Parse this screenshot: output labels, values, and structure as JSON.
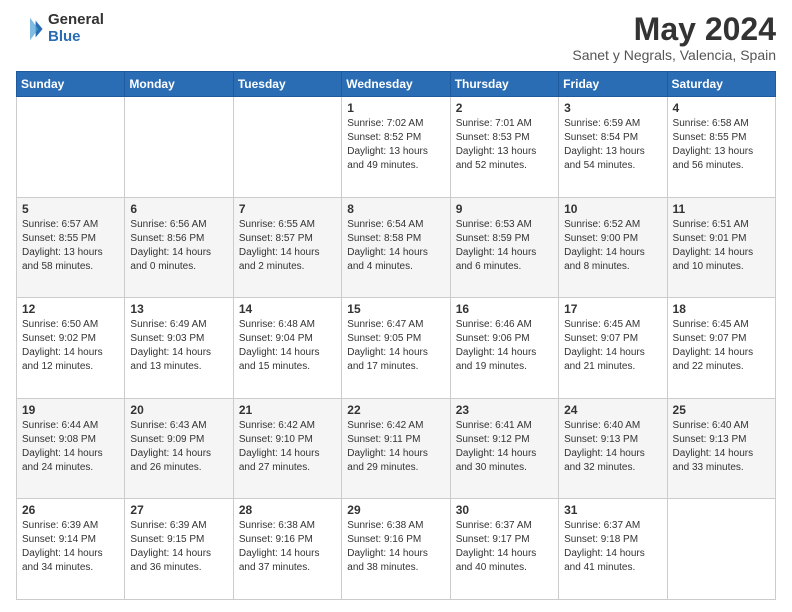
{
  "header": {
    "logo_general": "General",
    "logo_blue": "Blue",
    "title": "May 2024",
    "subtitle": "Sanet y Negrals, Valencia, Spain"
  },
  "days_of_week": [
    "Sunday",
    "Monday",
    "Tuesday",
    "Wednesday",
    "Thursday",
    "Friday",
    "Saturday"
  ],
  "weeks": [
    [
      {
        "day": "",
        "info": ""
      },
      {
        "day": "",
        "info": ""
      },
      {
        "day": "",
        "info": ""
      },
      {
        "day": "1",
        "info": "Sunrise: 7:02 AM\nSunset: 8:52 PM\nDaylight: 13 hours\nand 49 minutes."
      },
      {
        "day": "2",
        "info": "Sunrise: 7:01 AM\nSunset: 8:53 PM\nDaylight: 13 hours\nand 52 minutes."
      },
      {
        "day": "3",
        "info": "Sunrise: 6:59 AM\nSunset: 8:54 PM\nDaylight: 13 hours\nand 54 minutes."
      },
      {
        "day": "4",
        "info": "Sunrise: 6:58 AM\nSunset: 8:55 PM\nDaylight: 13 hours\nand 56 minutes."
      }
    ],
    [
      {
        "day": "5",
        "info": "Sunrise: 6:57 AM\nSunset: 8:55 PM\nDaylight: 13 hours\nand 58 minutes."
      },
      {
        "day": "6",
        "info": "Sunrise: 6:56 AM\nSunset: 8:56 PM\nDaylight: 14 hours\nand 0 minutes."
      },
      {
        "day": "7",
        "info": "Sunrise: 6:55 AM\nSunset: 8:57 PM\nDaylight: 14 hours\nand 2 minutes."
      },
      {
        "day": "8",
        "info": "Sunrise: 6:54 AM\nSunset: 8:58 PM\nDaylight: 14 hours\nand 4 minutes."
      },
      {
        "day": "9",
        "info": "Sunrise: 6:53 AM\nSunset: 8:59 PM\nDaylight: 14 hours\nand 6 minutes."
      },
      {
        "day": "10",
        "info": "Sunrise: 6:52 AM\nSunset: 9:00 PM\nDaylight: 14 hours\nand 8 minutes."
      },
      {
        "day": "11",
        "info": "Sunrise: 6:51 AM\nSunset: 9:01 PM\nDaylight: 14 hours\nand 10 minutes."
      }
    ],
    [
      {
        "day": "12",
        "info": "Sunrise: 6:50 AM\nSunset: 9:02 PM\nDaylight: 14 hours\nand 12 minutes."
      },
      {
        "day": "13",
        "info": "Sunrise: 6:49 AM\nSunset: 9:03 PM\nDaylight: 14 hours\nand 13 minutes."
      },
      {
        "day": "14",
        "info": "Sunrise: 6:48 AM\nSunset: 9:04 PM\nDaylight: 14 hours\nand 15 minutes."
      },
      {
        "day": "15",
        "info": "Sunrise: 6:47 AM\nSunset: 9:05 PM\nDaylight: 14 hours\nand 17 minutes."
      },
      {
        "day": "16",
        "info": "Sunrise: 6:46 AM\nSunset: 9:06 PM\nDaylight: 14 hours\nand 19 minutes."
      },
      {
        "day": "17",
        "info": "Sunrise: 6:45 AM\nSunset: 9:07 PM\nDaylight: 14 hours\nand 21 minutes."
      },
      {
        "day": "18",
        "info": "Sunrise: 6:45 AM\nSunset: 9:07 PM\nDaylight: 14 hours\nand 22 minutes."
      }
    ],
    [
      {
        "day": "19",
        "info": "Sunrise: 6:44 AM\nSunset: 9:08 PM\nDaylight: 14 hours\nand 24 minutes."
      },
      {
        "day": "20",
        "info": "Sunrise: 6:43 AM\nSunset: 9:09 PM\nDaylight: 14 hours\nand 26 minutes."
      },
      {
        "day": "21",
        "info": "Sunrise: 6:42 AM\nSunset: 9:10 PM\nDaylight: 14 hours\nand 27 minutes."
      },
      {
        "day": "22",
        "info": "Sunrise: 6:42 AM\nSunset: 9:11 PM\nDaylight: 14 hours\nand 29 minutes."
      },
      {
        "day": "23",
        "info": "Sunrise: 6:41 AM\nSunset: 9:12 PM\nDaylight: 14 hours\nand 30 minutes."
      },
      {
        "day": "24",
        "info": "Sunrise: 6:40 AM\nSunset: 9:13 PM\nDaylight: 14 hours\nand 32 minutes."
      },
      {
        "day": "25",
        "info": "Sunrise: 6:40 AM\nSunset: 9:13 PM\nDaylight: 14 hours\nand 33 minutes."
      }
    ],
    [
      {
        "day": "26",
        "info": "Sunrise: 6:39 AM\nSunset: 9:14 PM\nDaylight: 14 hours\nand 34 minutes."
      },
      {
        "day": "27",
        "info": "Sunrise: 6:39 AM\nSunset: 9:15 PM\nDaylight: 14 hours\nand 36 minutes."
      },
      {
        "day": "28",
        "info": "Sunrise: 6:38 AM\nSunset: 9:16 PM\nDaylight: 14 hours\nand 37 minutes."
      },
      {
        "day": "29",
        "info": "Sunrise: 6:38 AM\nSunset: 9:16 PM\nDaylight: 14 hours\nand 38 minutes."
      },
      {
        "day": "30",
        "info": "Sunrise: 6:37 AM\nSunset: 9:17 PM\nDaylight: 14 hours\nand 40 minutes."
      },
      {
        "day": "31",
        "info": "Sunrise: 6:37 AM\nSunset: 9:18 PM\nDaylight: 14 hours\nand 41 minutes."
      },
      {
        "day": "",
        "info": ""
      }
    ]
  ]
}
